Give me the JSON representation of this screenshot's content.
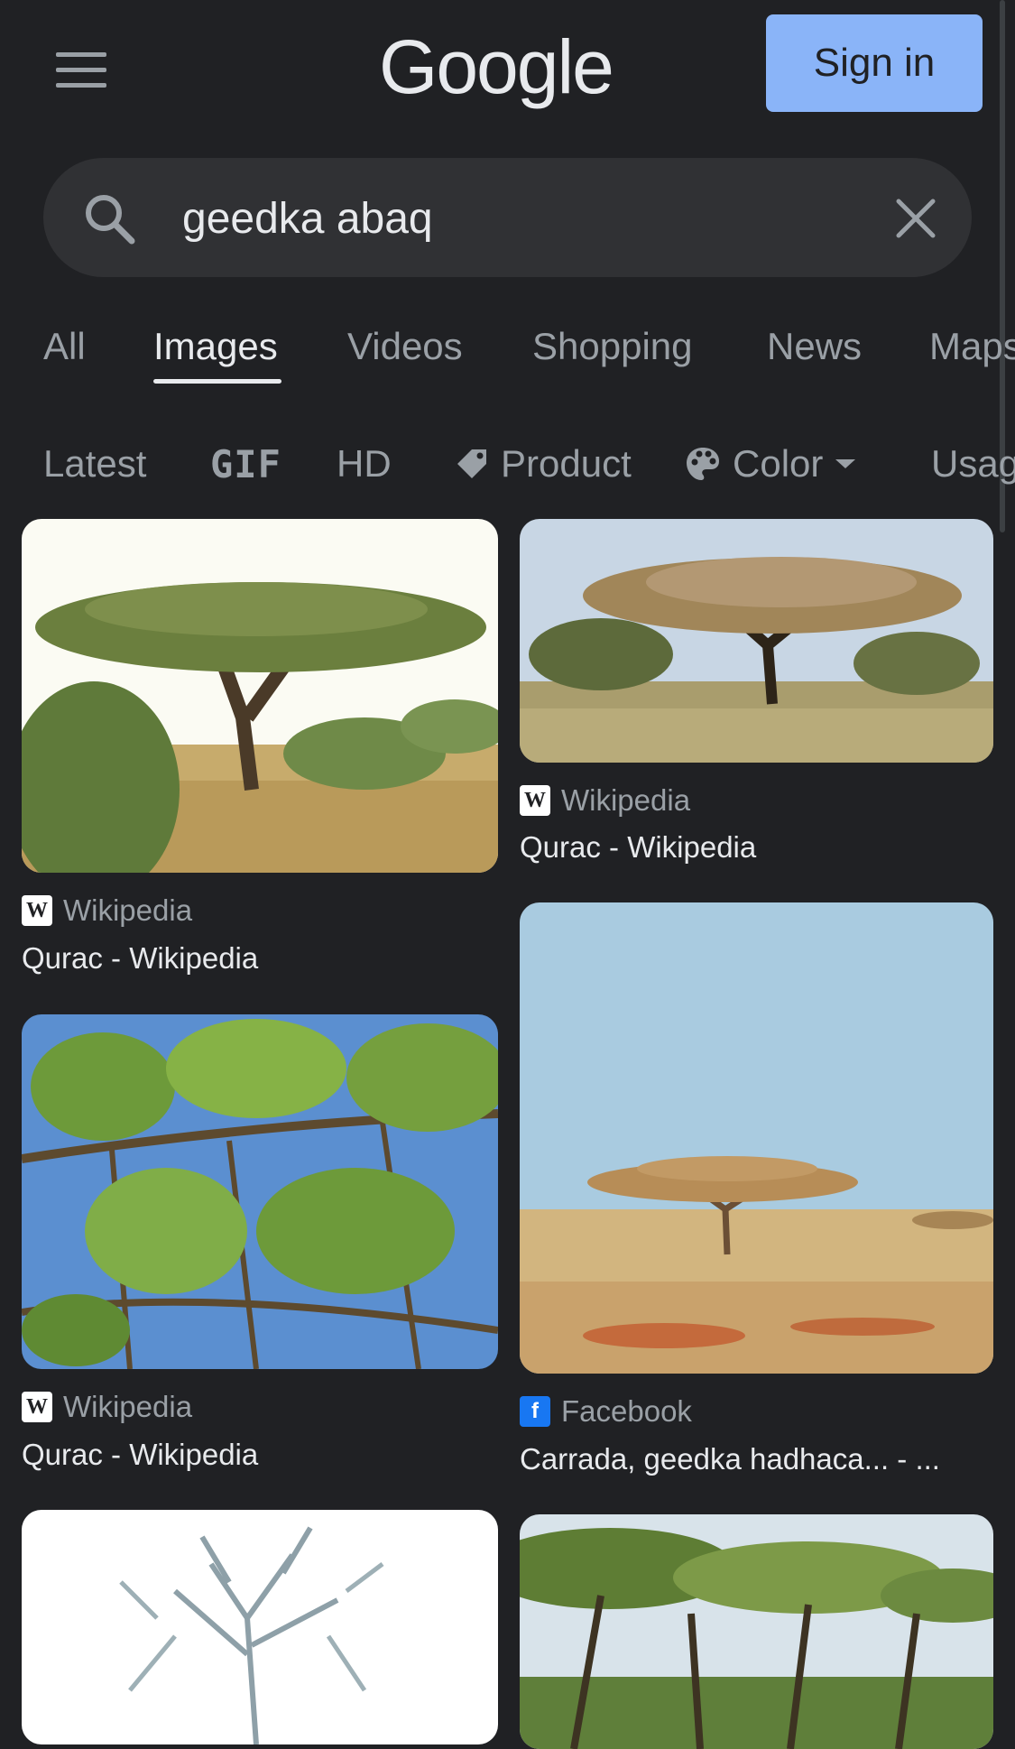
{
  "header": {
    "logo": "Google",
    "signin_label": "Sign in"
  },
  "search": {
    "query": "geedka abaq"
  },
  "tabs": [
    {
      "label": "All",
      "active": false
    },
    {
      "label": "Images",
      "active": true
    },
    {
      "label": "Videos",
      "active": false
    },
    {
      "label": "Shopping",
      "active": false
    },
    {
      "label": "News",
      "active": false
    },
    {
      "label": "Maps",
      "active": false
    }
  ],
  "chips": [
    {
      "label": "Latest",
      "icon": ""
    },
    {
      "label": "GIF",
      "icon": ""
    },
    {
      "label": "HD",
      "icon": ""
    },
    {
      "label": "Product",
      "icon": "tag-icon"
    },
    {
      "label": "Color",
      "icon": "palette-icon"
    },
    {
      "label": "Usage rights",
      "icon": ""
    }
  ],
  "results": [
    {
      "source": "Wikipedia",
      "title": "Qurac - Wikipedia",
      "favicon": "wikipedia-icon",
      "scene": "acacia-tree-savanna"
    },
    {
      "source": "Wikipedia",
      "title": "Qurac - Wikipedia",
      "favicon": "wikipedia-icon",
      "scene": "acacia-wide-savanna"
    },
    {
      "source": "Wikipedia",
      "title": "Qurac - Wikipedia",
      "favicon": "wikipedia-icon",
      "scene": "acacia-leaves-sky"
    },
    {
      "source": "Facebook",
      "title": "Carrada, geedka hadhaca... - ...",
      "favicon": "facebook-icon",
      "scene": "lone-acacia-plain"
    },
    {
      "source": "",
      "title": "",
      "favicon": "",
      "scene": "white-bush"
    },
    {
      "source": "",
      "title": "",
      "favicon": "",
      "scene": "acacia-grove"
    }
  ],
  "colors": {
    "background": "#202124",
    "accent": "#8ab4f8",
    "text": "#e8eaed",
    "muted": "#9aa0a6"
  }
}
